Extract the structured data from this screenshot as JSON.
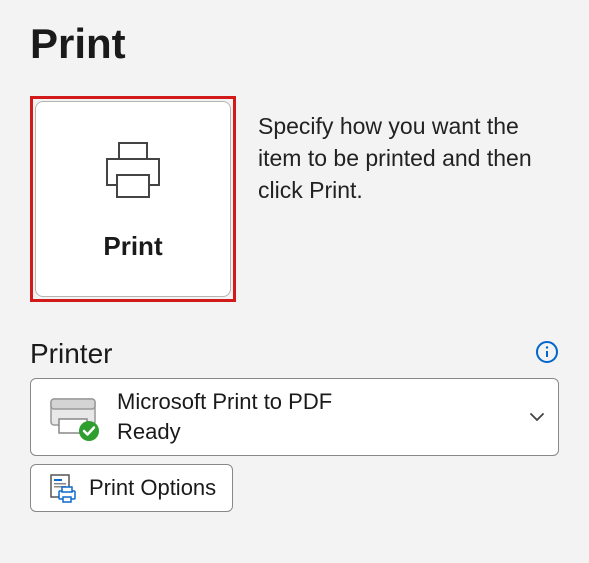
{
  "page_title": "Print",
  "print_button_label": "Print",
  "description": "Specify how you want the item to be printed and then click Print.",
  "printer_section": {
    "heading": "Printer",
    "selected": {
      "name": "Microsoft Print to PDF",
      "status": "Ready"
    }
  },
  "print_options_label": "Print Options",
  "colors": {
    "highlight_border": "#d21a1a",
    "info_icon": "#0066cc",
    "check_badge": "#2e9e2e"
  }
}
